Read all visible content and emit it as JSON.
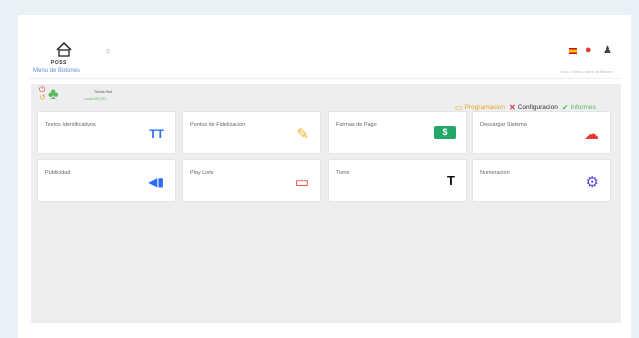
{
  "topbar": {
    "logo_text": "POSS",
    "dot": "o",
    "user_icon": "user-icon",
    "pin_icon": "map-pin-icon"
  },
  "menu": {
    "title": "Menu de Botones",
    "breadcrumb": "Inicio > Menu > Menu de Botones"
  },
  "store": {
    "name": "Tienda Test",
    "local": "Local 0001TD"
  },
  "actions": [
    {
      "label": "Programacion",
      "icon": "monitor-icon",
      "color": "#f0a020"
    },
    {
      "label": "Configuracion",
      "icon": "close-icon",
      "color": "#e53935"
    },
    {
      "label": "Informes",
      "icon": "check-icon",
      "color": "#5cb85c"
    }
  ],
  "cards": [
    {
      "label": "Textos Identificativos",
      "icon": "text-size-icon",
      "color": "#2a6df4",
      "glyph": "TT"
    },
    {
      "label": "Puntos de Fidelizacion",
      "icon": "edit-note-icon",
      "color": "#f0b429",
      "glyph": "✎"
    },
    {
      "label": "Formas de Pago",
      "icon": "cash-icon",
      "color": "#22a867",
      "glyph": "$"
    },
    {
      "label": "Descargar Sistema",
      "icon": "cloud-download-icon",
      "color": "#e53935",
      "glyph": "☁"
    },
    {
      "label": "Publicidad",
      "icon": "megaphone-icon",
      "color": "#2a6df4",
      "glyph": "📢"
    },
    {
      "label": "Play Lists",
      "icon": "monitor-icon",
      "color": "#e53935",
      "glyph": "▭"
    },
    {
      "label": "Tiene",
      "icon": "text-icon",
      "color": "#111111",
      "glyph": "T"
    },
    {
      "label": "Numeracion",
      "icon": "gear-icon",
      "color": "#5b4bdb",
      "glyph": "⚙"
    }
  ]
}
